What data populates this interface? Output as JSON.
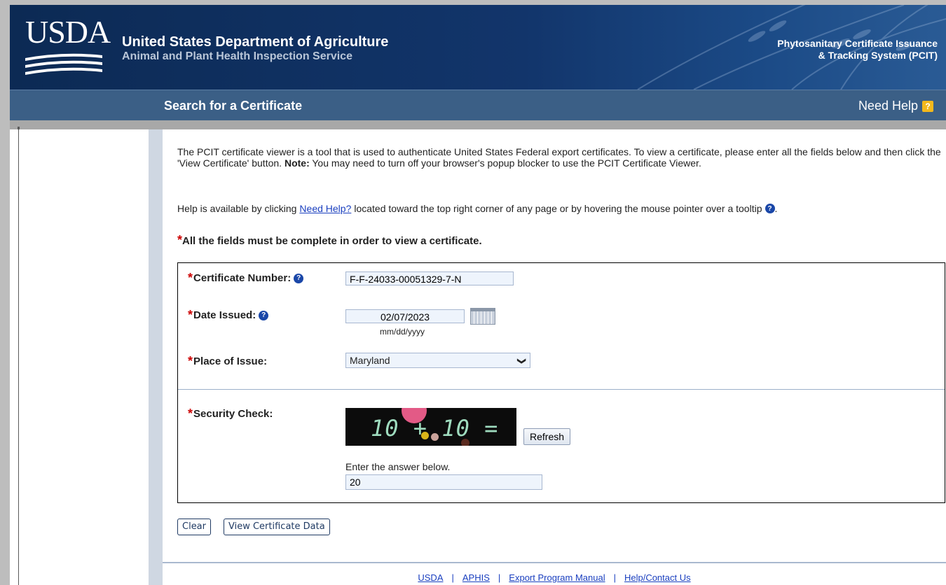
{
  "header": {
    "logo_text": "USDA",
    "agency_line1": "United States Department of Agriculture",
    "agency_line2": "Animal and Plant Health Inspection Service",
    "system_line1": "Phytosanitary Certificate Issuance",
    "system_line2": "& Tracking System (PCIT)"
  },
  "titlebar": {
    "title": "Search for a Certificate",
    "help_label": "Need Help",
    "help_icon": "?"
  },
  "intro": {
    "text_before_note": "The PCIT certificate viewer is a tool that is used to authenticate United States Federal export certificates. To view a certificate, please enter all the fields below and then click the 'View Certificate' button. ",
    "note_label": "Note:",
    "text_after_note": " You may need to turn off your browser's popup blocker to use the PCIT Certificate Viewer.",
    "help_prefix": "Help is available by clicking",
    "help_link": "Need Help?",
    "help_suffix": "located toward the top right corner of any page or by hovering the mouse pointer over a tooltip",
    "help_end": ".",
    "required_star": "*",
    "required_text": "All the fields must be complete in order to view a certificate."
  },
  "form": {
    "certificate_number": {
      "label": "Certificate Number:",
      "value": "F-F-24033-00051329-7-N"
    },
    "date_issued": {
      "label": "Date Issued:",
      "value": "02/07/2023",
      "hint": "mm/dd/yyyy"
    },
    "place_of_issue": {
      "label": "Place of Issue:",
      "value": "Maryland"
    },
    "security_check": {
      "label": "Security Check:",
      "captcha_text": "10 + 10 =",
      "refresh_label": "Refresh",
      "answer_prompt": "Enter the answer below.",
      "answer_value": "20"
    },
    "star": "*"
  },
  "actions": {
    "clear_label": "Clear",
    "view_label": "View Certificate Data"
  },
  "footer": {
    "links": [
      "USDA",
      "APHIS",
      "Export Program Manual",
      "Help/Contact Us"
    ],
    "separator": "|"
  },
  "icons": {
    "tooltip": "?",
    "tooltip_color": "#1a47a8",
    "help_color": "#f3b81c",
    "chevron": "❯"
  }
}
